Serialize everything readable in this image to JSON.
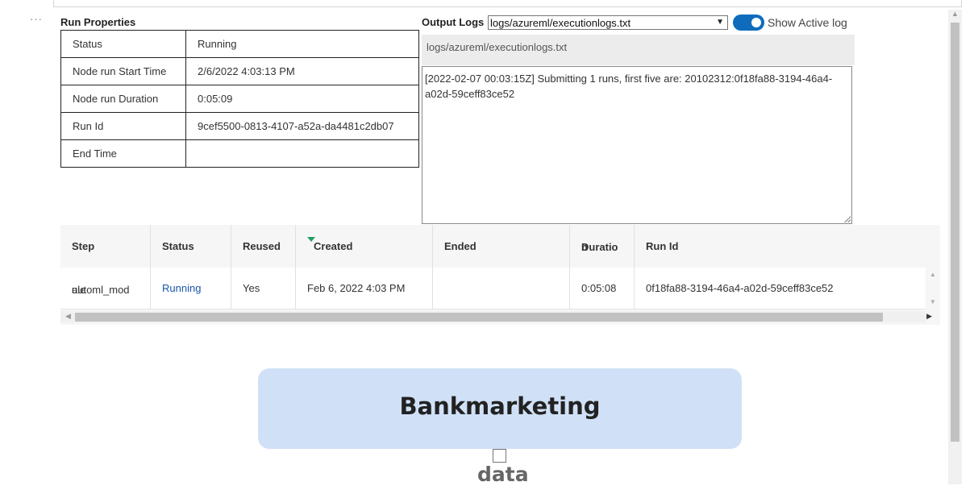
{
  "run_properties": {
    "title": "Run Properties",
    "rows": [
      {
        "key": "Status",
        "value": "Running"
      },
      {
        "key": "Node run Start Time",
        "value": "2/6/2022 4:03:13 PM"
      },
      {
        "key": "Node run Duration",
        "value": "0:05:09"
      },
      {
        "key": "Run Id",
        "value": "9cef5500-0813-4107-a52a-da4481c2db07"
      },
      {
        "key": "End Time",
        "value": ""
      }
    ]
  },
  "output_logs": {
    "title": "Output Logs",
    "selected_log": "logs/azureml/executionlogs.txt",
    "toggle_label": "Show Active log",
    "path_display": "logs/azureml/executionlogs.txt",
    "log_content": "[2022-02-07 00:03:15Z] Submitting 1 runs, first five are: 20102312:0f18fa88-3194-46a4-a02d-59ceff83ce52"
  },
  "steps_grid": {
    "headers": {
      "step": "Step",
      "status": "Status",
      "reused": "Reused",
      "created": "Created",
      "ended": "Ended",
      "duration_1": "Duratio",
      "duration_2": "n",
      "run_id": "Run Id"
    },
    "rows": [
      {
        "step_1": "automl_mod",
        "step_2": "ule",
        "status": "Running",
        "reused": "Yes",
        "created": "Feb 6, 2022 4:03 PM",
        "ended": "",
        "duration": "0:05:08",
        "run_id": "0f18fa88-3194-46a4-a02d-59ceff83ce52"
      }
    ]
  },
  "graph": {
    "node_label": "Bankmarketing",
    "port_label": "data"
  },
  "colors": {
    "link": "#1a56a8",
    "toggle_on": "#0f6cbd",
    "graph_node": "#d0e1f7",
    "sort_indicator": "#20a060"
  }
}
